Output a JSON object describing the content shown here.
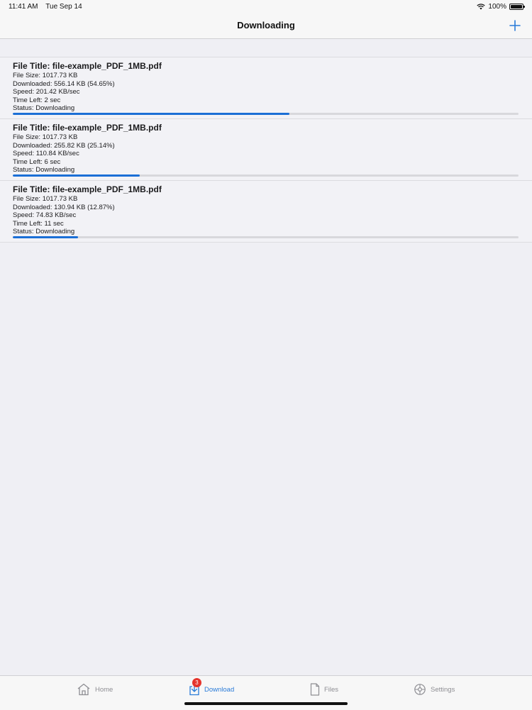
{
  "status_bar": {
    "time": "11:41 AM",
    "date": "Tue Sep 14",
    "battery": "100%",
    "icons": [
      "wifi-icon",
      "battery-icon"
    ]
  },
  "nav": {
    "title": "Downloading",
    "add_icon": "plus-icon"
  },
  "downloads": [
    {
      "title": "File Title: file-example_PDF_1MB.pdf",
      "size": "File Size: 1017.73 KB",
      "downloaded": "Downloaded: 556.14 KB (54.65%)",
      "speed": "Speed: 201.42 KB/sec",
      "time_left": "Time Left: 2 sec",
      "status": "Status: Downloading",
      "progress": 0.5465
    },
    {
      "title": "File Title: file-example_PDF_1MB.pdf",
      "size": "File Size: 1017.73 KB",
      "downloaded": "Downloaded: 255.82 KB (25.14%)",
      "speed": "Speed: 110.84 KB/sec",
      "time_left": "Time Left: 6 sec",
      "status": "Status: Downloading",
      "progress": 0.2514
    },
    {
      "title": "File Title: file-example_PDF_1MB.pdf",
      "size": "File Size: 1017.73 KB",
      "downloaded": "Downloaded: 130.94 KB (12.87%)",
      "speed": "Speed: 74.83 KB/sec",
      "time_left": "Time Left: 11 sec",
      "status": "Status: Downloading",
      "progress": 0.1287
    }
  ],
  "tabs": [
    {
      "label": "Home",
      "icon": "home-icon",
      "active": false
    },
    {
      "label": "Download",
      "icon": "download-icon",
      "active": true,
      "badge": "3"
    },
    {
      "label": "Files",
      "icon": "file-icon",
      "active": false
    },
    {
      "label": "Settings",
      "icon": "gear-icon",
      "active": false
    }
  ],
  "colors": {
    "accent": "#2a7bd8",
    "progress": "#1b6fd6",
    "badge": "#e5342c",
    "inactive": "#8e8e93"
  }
}
